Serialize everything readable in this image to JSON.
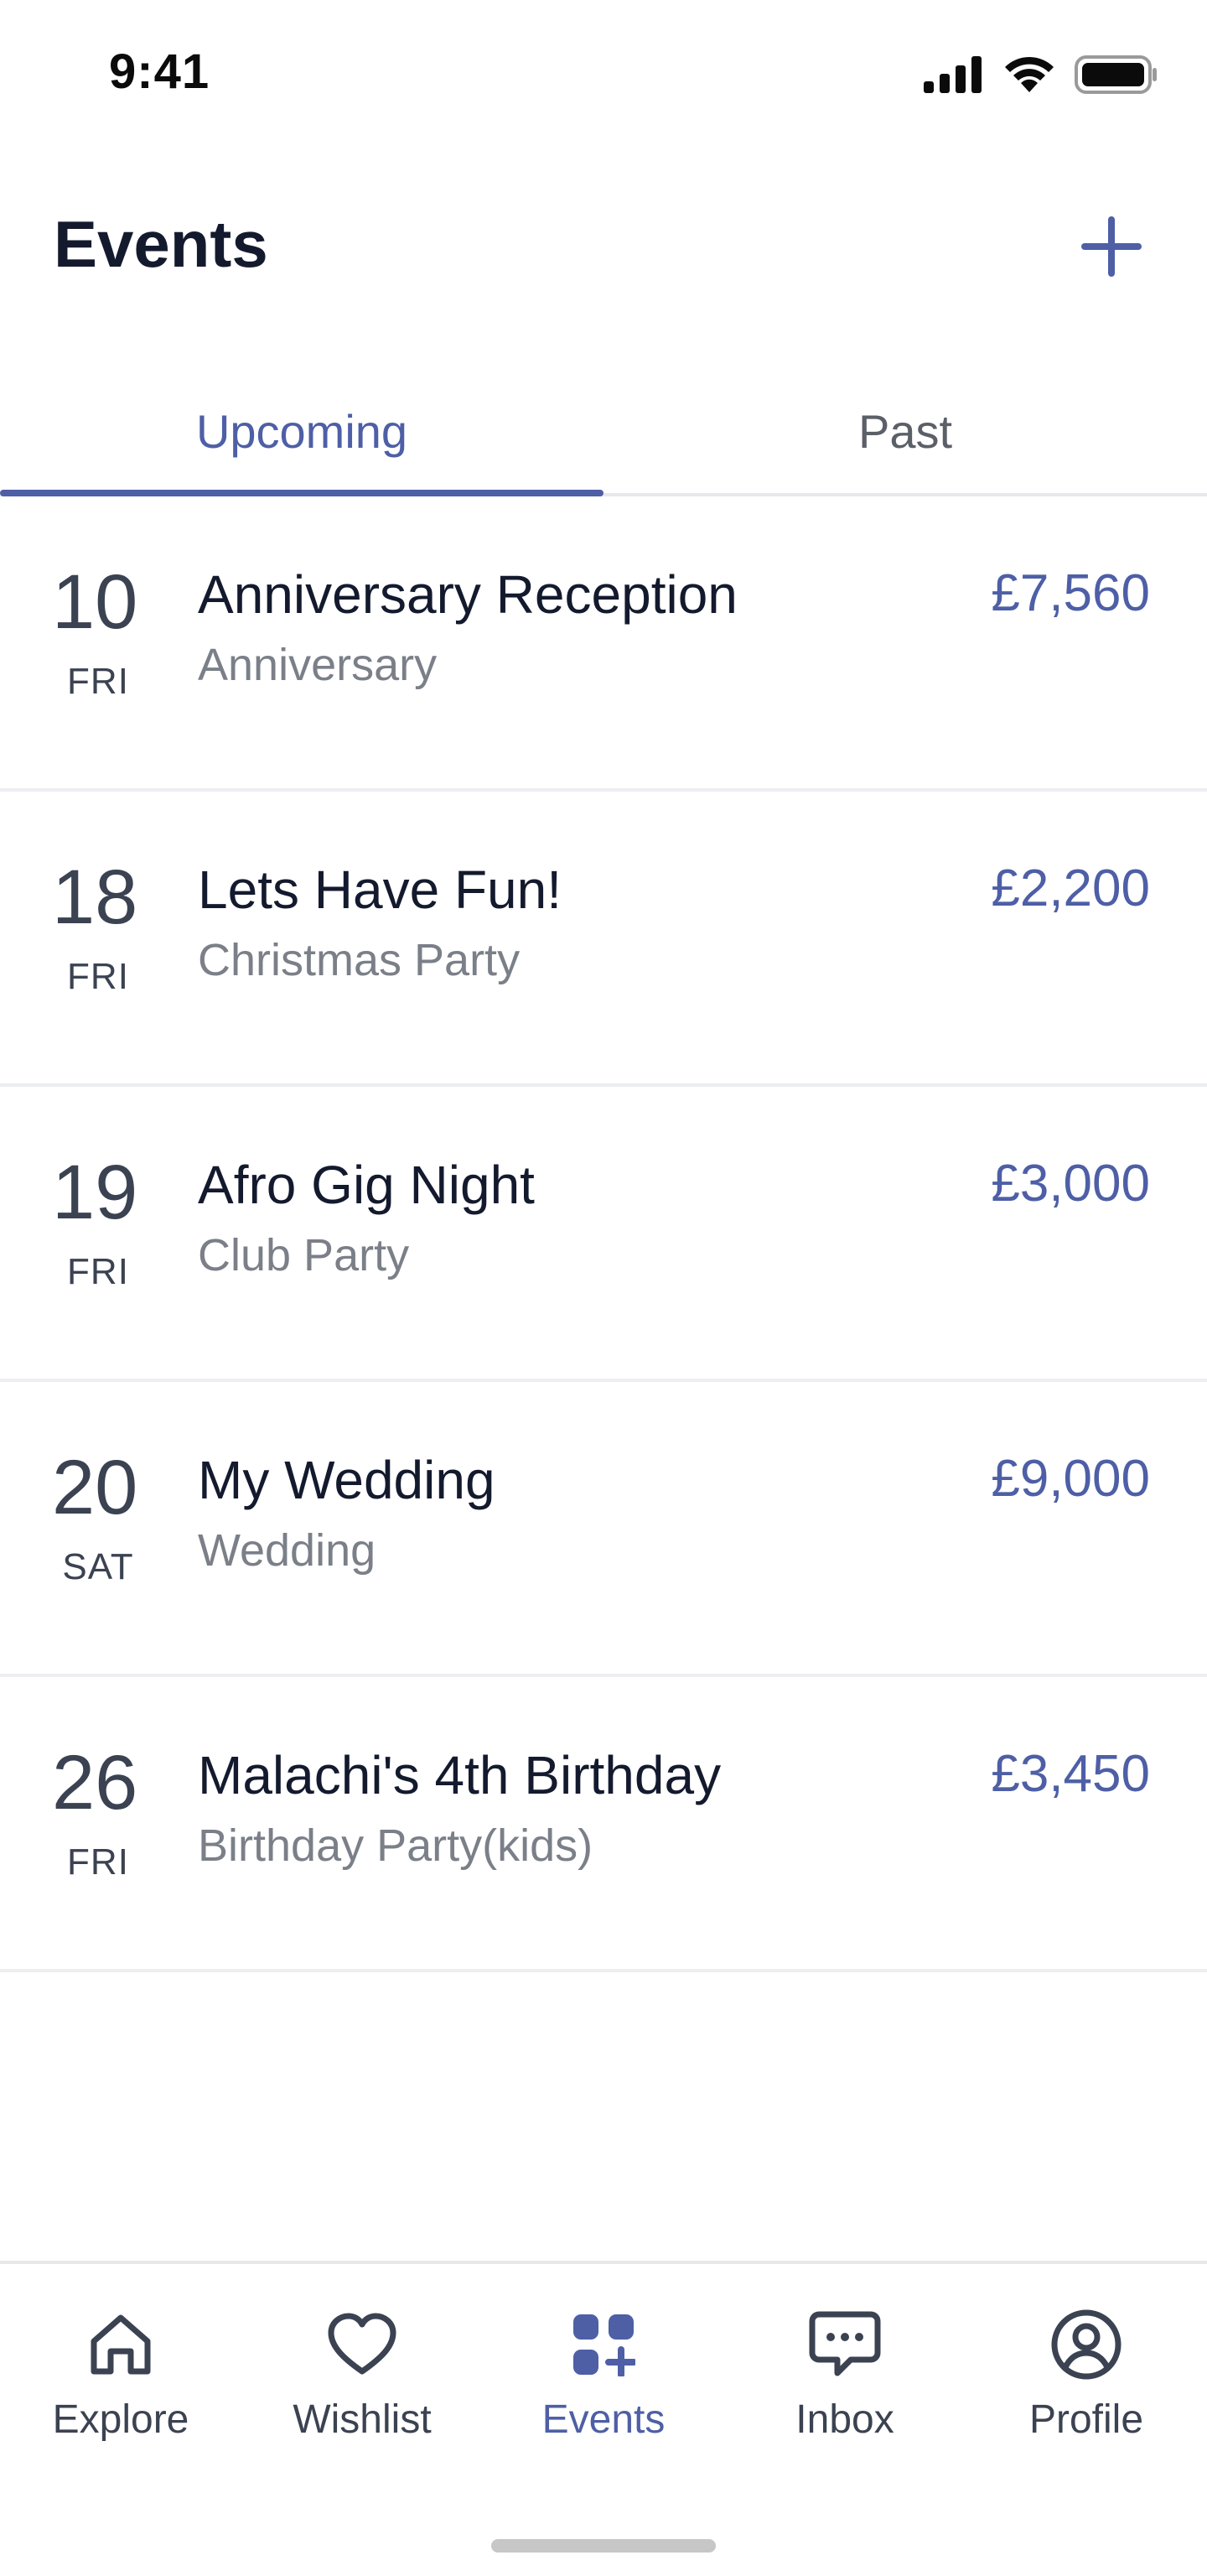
{
  "status_bar": {
    "time": "9:41",
    "icons": [
      "signal-icon",
      "wifi-icon",
      "battery-icon"
    ]
  },
  "header": {
    "title": "Events",
    "add_icon": "plus-icon"
  },
  "tabs": [
    {
      "label": "Upcoming",
      "active": true
    },
    {
      "label": "Past",
      "active": false
    }
  ],
  "events": [
    {
      "day": "10",
      "weekday": "FRI",
      "title": "Anniversary Reception",
      "category": "Anniversary",
      "price": "£7,560"
    },
    {
      "day": "18",
      "weekday": "FRI",
      "title": "Lets Have Fun!",
      "category": "Christmas Party",
      "price": "£2,200"
    },
    {
      "day": "19",
      "weekday": "FRI",
      "title": "Afro Gig Night",
      "category": "Club Party",
      "price": "£3,000"
    },
    {
      "day": "20",
      "weekday": "SAT",
      "title": "My Wedding",
      "category": "Wedding",
      "price": "£9,000"
    },
    {
      "day": "26",
      "weekday": "FRI",
      "title": "Malachi's 4th Birthday",
      "category": "Birthday Party(kids)",
      "price": "£3,450"
    }
  ],
  "bottom_nav": [
    {
      "label": "Explore",
      "icon": "home-icon",
      "active": false
    },
    {
      "label": "Wishlist",
      "icon": "heart-icon",
      "active": false
    },
    {
      "label": "Events",
      "icon": "events-grid-icon",
      "active": true
    },
    {
      "label": "Inbox",
      "icon": "chat-icon",
      "active": false
    },
    {
      "label": "Profile",
      "icon": "profile-icon",
      "active": false
    }
  ],
  "colors": {
    "accent": "#4e5fa6",
    "text_primary": "#141a2e",
    "text_secondary": "#7a7f88",
    "divider": "#eceef1"
  }
}
